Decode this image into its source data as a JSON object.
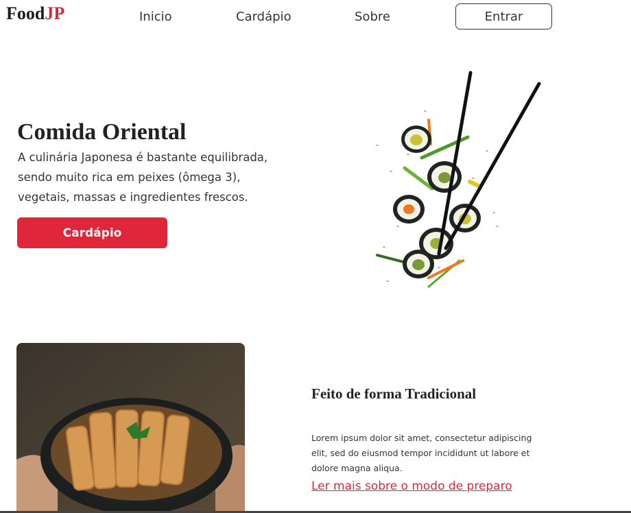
{
  "header": {
    "logo_main": "Food",
    "logo_accent": "JP",
    "nav": [
      "Inicio",
      "Cardápio",
      "Sobre"
    ],
    "login_label": "Entrar"
  },
  "hero": {
    "title": "Comida Oriental",
    "description": "A culinária Japonesa é bastante equilibrada, sendo muito rica em peixes (ômega 3), vegetais, massas e ingredientes frescos.",
    "button_label": "Cardápio"
  },
  "feature": {
    "title": "Feito de forma Tradicional",
    "text": "Lorem ipsum dolor sit amet, consectetur adipiscing elit, sed do eiusmod tempor incididunt ut labore et dolore magna aliqua.",
    "link_label": "Ler mais sobre o modo de preparo"
  },
  "colors": {
    "accent": "#e0263b",
    "text": "#222222",
    "background": "#ffffff"
  }
}
